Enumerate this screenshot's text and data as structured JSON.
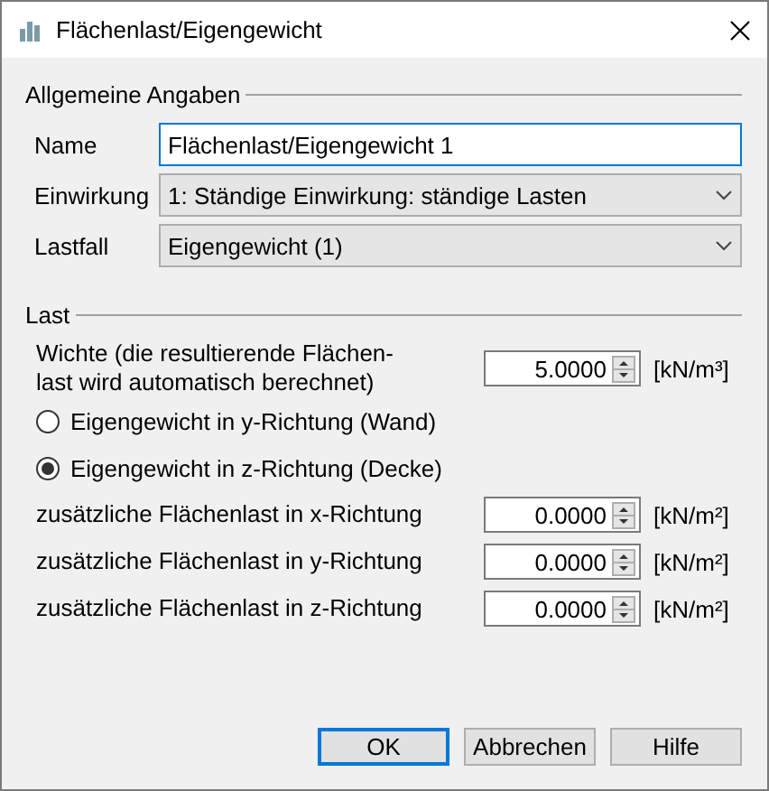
{
  "window": {
    "title": "Flächenlast/Eigengewicht"
  },
  "general": {
    "title": "Allgemeine Angaben",
    "fields": [
      {
        "kind": "text",
        "label": "Name",
        "value": "Flächenlast/Eigengewicht 1",
        "focused": true
      },
      {
        "kind": "dropdown",
        "label": "Einwirkung",
        "value": "1: Ständige Einwirkung: ständige Lasten"
      },
      {
        "kind": "dropdown",
        "label": "Lastfall",
        "value": "Eigengewicht (1)"
      }
    ]
  },
  "load": {
    "title": "Last",
    "rows": [
      {
        "kind": "spin",
        "label": "Wichte (die resultierende Flächen-\nlast wird automatisch berechnet)",
        "value": "5.0000",
        "unit": "[kN/m³]"
      },
      {
        "kind": "radio",
        "label": "Eigengewicht in y-Richtung (Wand)",
        "selected": false
      },
      {
        "kind": "radio",
        "label": "Eigengewicht in z-Richtung (Decke)",
        "selected": true
      },
      {
        "kind": "spin",
        "label": "zusätzliche Flächenlast in x-Richtung",
        "value": "0.0000",
        "unit": "[kN/m²]"
      },
      {
        "kind": "spin",
        "label": "zusätzliche Flächenlast in y-Richtung",
        "value": "0.0000",
        "unit": "[kN/m²]"
      },
      {
        "kind": "spin",
        "label": "zusätzliche Flächenlast in z-Richtung",
        "value": "0.0000",
        "unit": "[kN/m²]"
      }
    ]
  },
  "buttons": [
    {
      "label": "OK",
      "default": true
    },
    {
      "label": "Abbrechen",
      "default": false
    },
    {
      "label": "Hilfe",
      "default": false
    }
  ]
}
